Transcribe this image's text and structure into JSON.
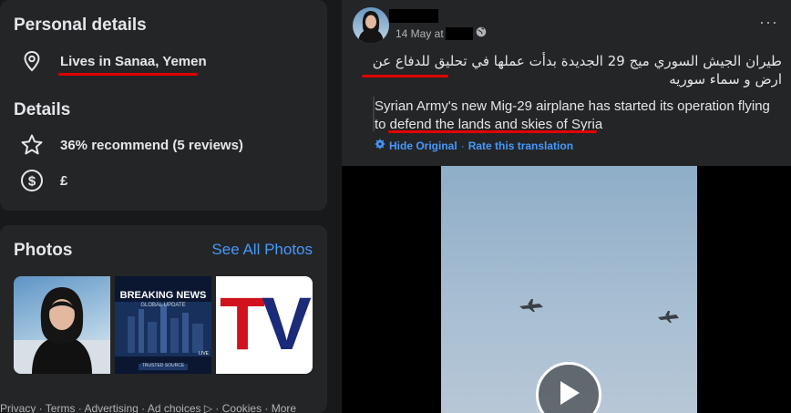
{
  "personal_details": {
    "title": "Personal details",
    "location_icon": "location-pin-icon",
    "location": "Lives in Sanaa, Yemen"
  },
  "details": {
    "title": "Details",
    "recommend_icon": "star-icon",
    "recommend": "36% recommend (5 reviews)",
    "price_icon": "dollar-circle-icon",
    "price": "£"
  },
  "photos": {
    "title": "Photos",
    "see_all": "See All Photos",
    "thumbs": [
      {
        "label": ""
      },
      {
        "headline": "BREAKING NEWS",
        "sub": "GLOBAL UPDATE",
        "caption": "TRUSTED SOURCE",
        "live": "LIVE"
      },
      {
        "text": "TV"
      }
    ]
  },
  "footer": "Privacy · Terms · Advertising · Ad choices ▷ · Cookies · More",
  "post": {
    "date": "14 May at",
    "audience_icon": "globe-icon",
    "more_icon": "more-dots-icon",
    "more_label": "···",
    "arabic_text": "طيران الجيش  السوري ميج 29 الجديدة بدأت عملها في  تحليق للدفاع عن ارض و سماء سوريه",
    "translation": "Syrian Army's new Mig-29 airplane has started its operation flying to defend the lands and skies of Syria",
    "hide_original": "Hide Original",
    "separator": "·",
    "rate_translation": "Rate this translation"
  },
  "colors": {
    "accent": "#4599ff",
    "highlight_underline": "#e00000",
    "card": "#242526",
    "background": "#18191a"
  }
}
